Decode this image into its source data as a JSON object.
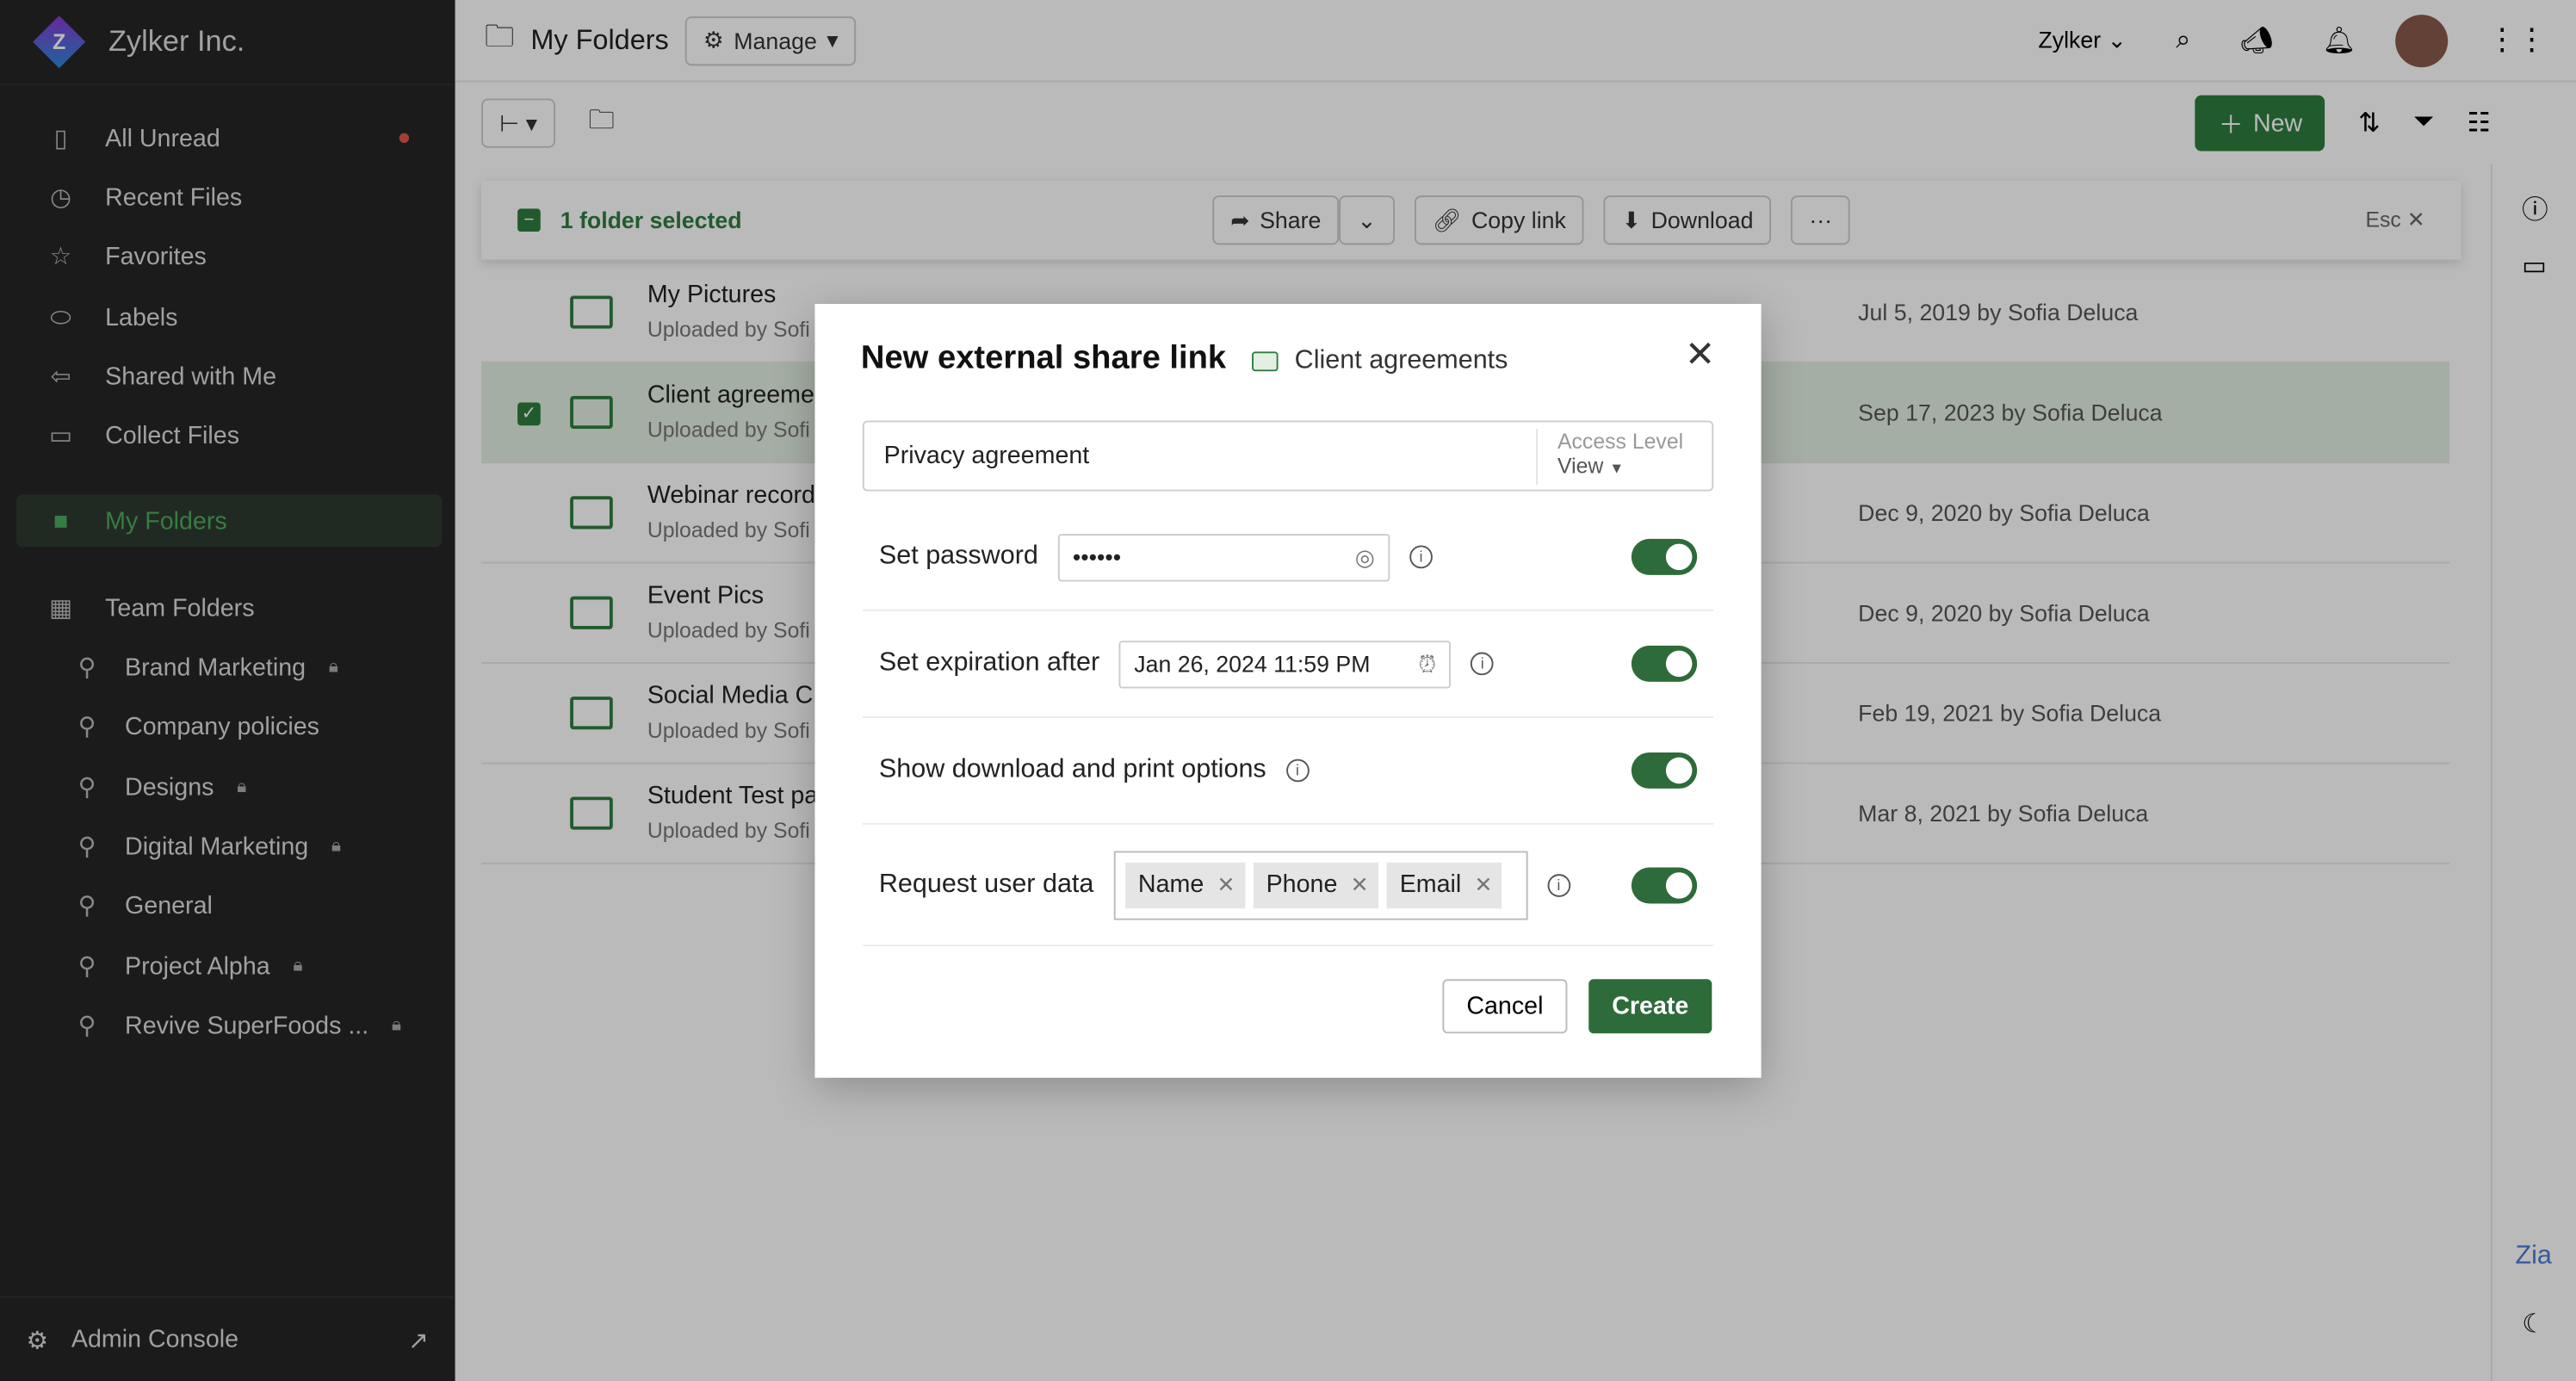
{
  "sidebar": {
    "org": "Zylker Inc.",
    "logo_letter": "Z",
    "items": [
      {
        "label": "All Unread",
        "icon": "unread-icon"
      },
      {
        "label": "Recent Files",
        "icon": "clock-icon"
      },
      {
        "label": "Favorites",
        "icon": "star-icon"
      },
      {
        "label": "Labels",
        "icon": "label-icon"
      },
      {
        "label": "Shared with Me",
        "icon": "share-icon"
      },
      {
        "label": "Collect Files",
        "icon": "inbox-icon"
      }
    ],
    "my_folders": "My Folders",
    "team_folders": "Team Folders",
    "teams": [
      {
        "label": "Brand Marketing",
        "locked": true
      },
      {
        "label": "Company policies",
        "locked": false
      },
      {
        "label": "Designs",
        "locked": true
      },
      {
        "label": "Digital Marketing",
        "locked": true
      },
      {
        "label": "General",
        "locked": false
      },
      {
        "label": "Project Alpha",
        "locked": true
      },
      {
        "label": "Revive SuperFoods ...",
        "locked": true
      }
    ],
    "admin": "Admin Console"
  },
  "header": {
    "title": "My Folders",
    "manage": "Manage",
    "org_switch": "Zylker",
    "new": "New"
  },
  "selection": {
    "text": "1 folder selected",
    "share": "Share",
    "copy_link": "Copy link",
    "download": "Download",
    "more": "···",
    "esc": "Esc"
  },
  "rows": [
    {
      "name": "My Pictures",
      "sub": "Uploaded by Sofi",
      "date": "Jul 5, 2019 by Sofia Deluca"
    },
    {
      "name": "Client agreeme",
      "sub": "Uploaded by Sofi",
      "date": "Sep 17, 2023 by Sofia Deluca",
      "selected": true
    },
    {
      "name": "Webinar record",
      "sub": "Uploaded by Sofi",
      "date": "Dec 9, 2020 by Sofia Deluca"
    },
    {
      "name": "Event Pics",
      "sub": "Uploaded by Sofi",
      "date": "Dec 9, 2020 by Sofia Deluca"
    },
    {
      "name": "Social Media C",
      "sub": "Uploaded by Sofi",
      "date": "Feb 19, 2021 by Sofia Deluca"
    },
    {
      "name": "Student Test pa",
      "sub": "Uploaded by Sofi",
      "date": "Mar 8, 2021 by Sofia Deluca"
    }
  ],
  "modal": {
    "title": "New external share link",
    "folder": "Client agreements",
    "link_name": "Privacy agreement",
    "access_label": "Access Level",
    "access_value": "View",
    "password_label": "Set password",
    "password_value": "••••••",
    "expiry_label": "Set expiration after",
    "expiry_value": "Jan 26, 2024 11:59 PM",
    "download_label": "Show download and print options",
    "request_label": "Request user data",
    "chips": [
      "Name",
      "Phone",
      "Email"
    ],
    "toggles": {
      "password": true,
      "expiry": true,
      "download": true,
      "request": true
    },
    "cancel": "Cancel",
    "create": "Create"
  },
  "colors": {
    "accent": "#2e7d3e",
    "sidebar": "#262626"
  }
}
